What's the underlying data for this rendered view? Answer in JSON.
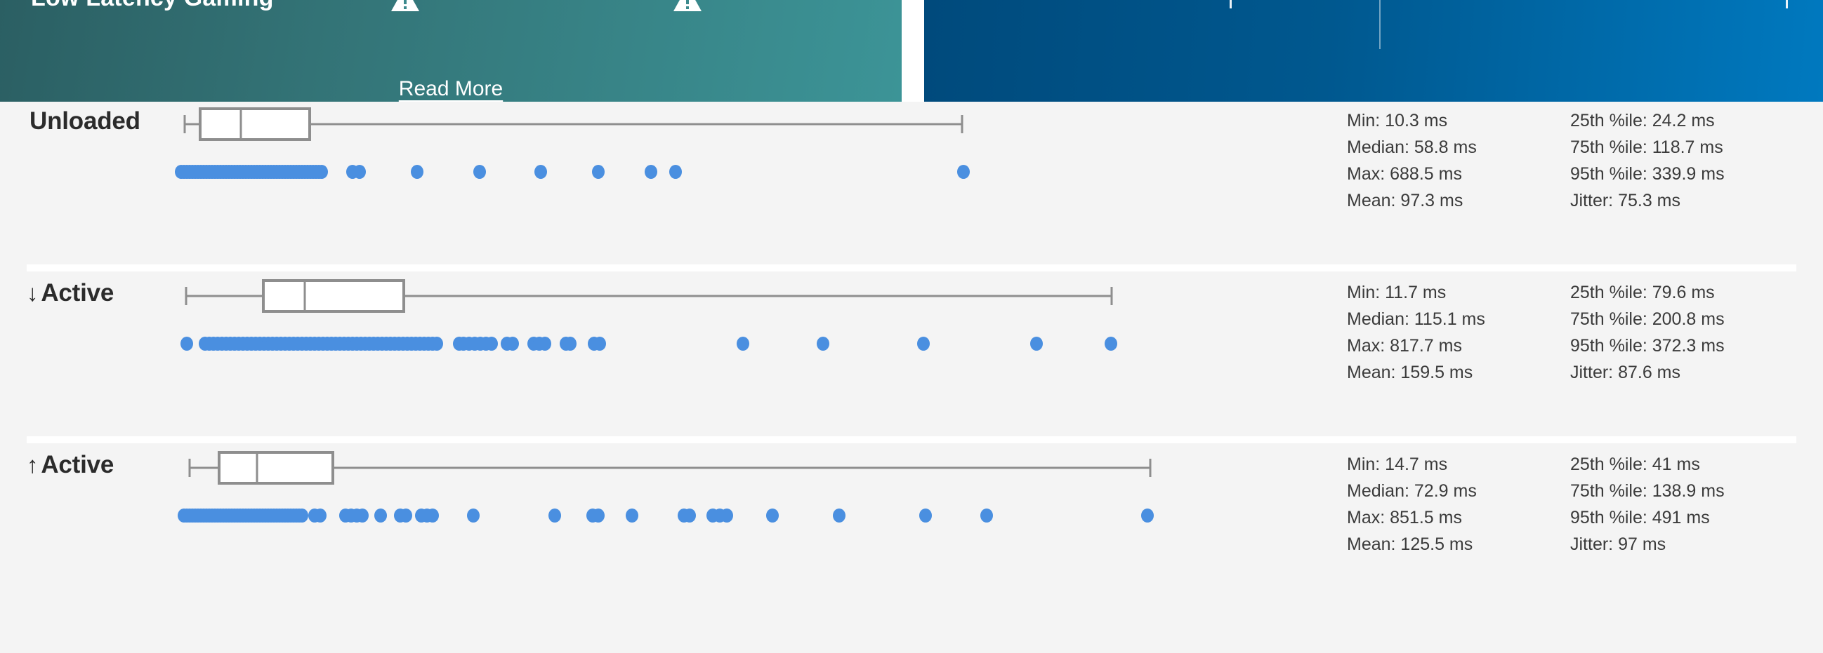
{
  "banner": {
    "promo": {
      "title": "Low Latency Gaming",
      "read_more_label": "Read More",
      "warning_icon_a": "warning-triangle-icon",
      "warning_icon_b": "warning-triangle-icon",
      "gradient_from": "#2b5f63",
      "gradient_to": "#3c9497"
    },
    "info": {
      "gradient_from": "#004a7c",
      "gradient_to": "#0079bf"
    }
  },
  "latency": {
    "background": "#f4f4f4",
    "dot_color": "#4a8fe0",
    "box_color": "#8e8e8e",
    "rows": [
      {
        "label": "Unloaded",
        "arrow": "",
        "stats_left": [
          "Min: 10.3 ms",
          "Median: 58.8 ms",
          "Max: 688.5 ms",
          "Mean: 97.3 ms"
        ],
        "stats_right": [
          "25th %ile: 24.2 ms",
          "75th %ile: 118.7 ms",
          "95th %ile: 339.9 ms",
          "Jitter: 75.3 ms"
        ],
        "box": {
          "whisker_low": 263,
          "q1": 285,
          "median": 343,
          "q3": 441,
          "whisker_high": 1370
        },
        "dots": [
          258,
          262,
          266,
          270,
          274,
          278,
          282,
          286,
          290,
          294,
          298,
          302,
          306,
          310,
          314,
          318,
          322,
          326,
          330,
          334,
          338,
          342,
          346,
          350,
          354,
          358,
          362,
          366,
          370,
          374,
          378,
          382,
          386,
          390,
          394,
          398,
          402,
          406,
          410,
          414,
          418,
          422,
          426,
          430,
          434,
          438,
          442,
          446,
          450,
          454,
          458,
          502,
          512,
          594,
          683,
          770,
          852,
          927,
          962,
          1372
        ]
      },
      {
        "label": "Active",
        "arrow": "↓",
        "stats_left": [
          "Min: 11.7 ms",
          "Median: 115.1 ms",
          "Max: 817.7 ms",
          "Mean: 159.5 ms"
        ],
        "stats_right": [
          "25th %ile: 79.6 ms",
          "75th %ile: 200.8 ms",
          "95th %ile: 372.3 ms",
          "Jitter: 87.6 ms"
        ],
        "box": {
          "whisker_low": 265,
          "q1": 375,
          "median": 434,
          "q3": 575,
          "whisker_high": 1583
        },
        "dots": [
          266,
          292,
          298,
          304,
          310,
          316,
          322,
          328,
          334,
          340,
          346,
          352,
          358,
          364,
          370,
          376,
          382,
          388,
          394,
          400,
          406,
          412,
          418,
          424,
          430,
          436,
          442,
          448,
          454,
          460,
          466,
          472,
          478,
          484,
          490,
          496,
          502,
          508,
          514,
          520,
          526,
          532,
          538,
          544,
          550,
          556,
          562,
          568,
          574,
          580,
          586,
          592,
          598,
          604,
          610,
          616,
          622,
          654,
          660,
          668,
          676,
          684,
          692,
          700,
          722,
          730,
          760,
          768,
          776,
          806,
          812,
          846,
          854,
          1058,
          1172,
          1315,
          1476,
          1582
        ]
      },
      {
        "label": "Active",
        "arrow": "↑",
        "stats_left": [
          "Min: 14.7 ms",
          "Median: 72.9 ms",
          "Max: 851.5 ms",
          "Mean: 125.5 ms"
        ],
        "stats_right": [
          "25th %ile: 41 ms",
          "75th %ile: 138.9 ms",
          "95th %ile: 491 ms",
          "Jitter: 97 ms"
        ],
        "box": {
          "whisker_low": 270,
          "q1": 312,
          "median": 366,
          "q3": 474,
          "whisker_high": 1638
        },
        "dots": [
          262,
          266,
          270,
          274,
          278,
          282,
          286,
          290,
          294,
          298,
          302,
          306,
          310,
          314,
          318,
          322,
          326,
          330,
          334,
          338,
          342,
          346,
          350,
          354,
          358,
          362,
          366,
          370,
          374,
          378,
          382,
          386,
          390,
          394,
          398,
          402,
          406,
          410,
          414,
          418,
          422,
          426,
          430,
          448,
          456,
          492,
          500,
          508,
          516,
          542,
          570,
          578,
          600,
          608,
          616,
          674,
          790,
          844,
          852,
          900,
          974,
          982,
          1015,
          1025,
          1035,
          1100,
          1195,
          1318,
          1405,
          1634
        ]
      }
    ]
  }
}
